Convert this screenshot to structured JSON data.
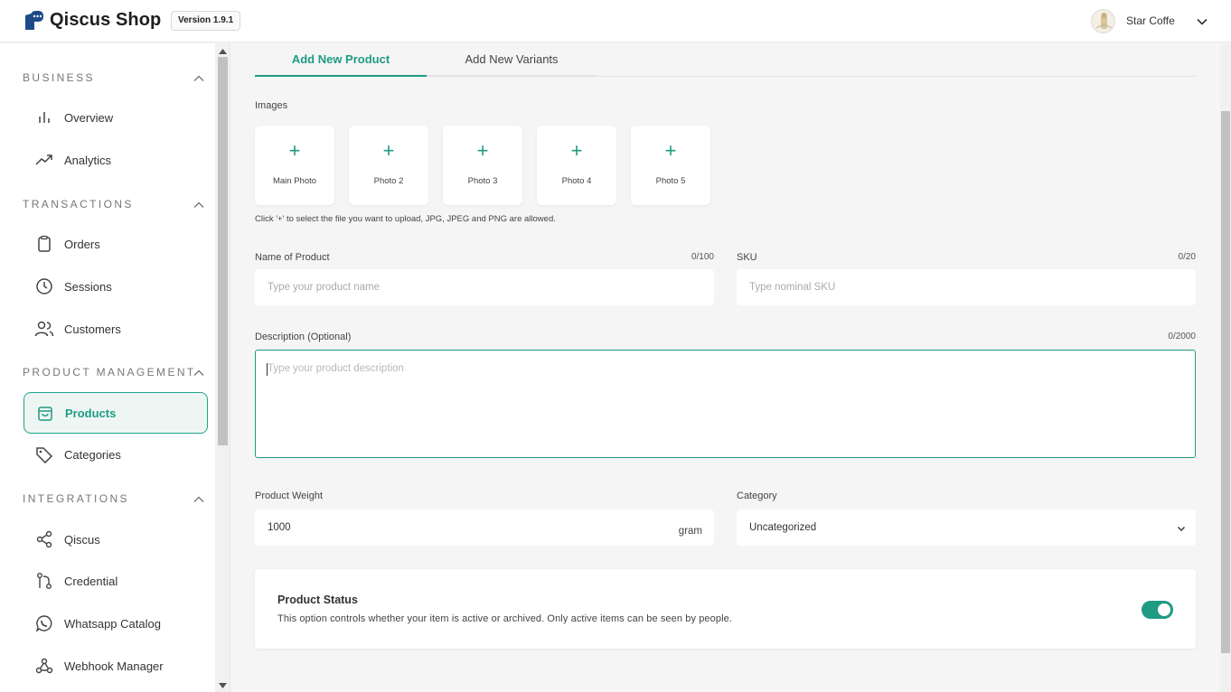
{
  "header": {
    "brand": "Qiscus Shop",
    "version": "Version 1.9.1",
    "store_name": "Star Coffe"
  },
  "sidebar": {
    "sections": [
      {
        "title": "BUSINESS"
      },
      {
        "title": "TRANSACTIONS"
      },
      {
        "title": "PRODUCT MANAGEMENT"
      },
      {
        "title": "INTEGRATIONS"
      }
    ],
    "items": [
      {
        "label": "Overview",
        "icon": "bar-chart-icon"
      },
      {
        "label": "Analytics",
        "icon": "trend-up-icon"
      },
      {
        "label": "Orders",
        "icon": "clipboard-icon"
      },
      {
        "label": "Sessions",
        "icon": "clock-icon"
      },
      {
        "label": "Customers",
        "icon": "users-icon"
      },
      {
        "label": "Products",
        "icon": "shopping-bag-icon",
        "active": true
      },
      {
        "label": "Categories",
        "icon": "tag-icon"
      },
      {
        "label": "Qiscus",
        "icon": "share-icon"
      },
      {
        "label": "Credential",
        "icon": "git-compare-icon"
      },
      {
        "label": "Whatsapp Catalog",
        "icon": "whatsapp-icon"
      },
      {
        "label": "Webhook Manager",
        "icon": "webhook-icon"
      }
    ]
  },
  "tabs": [
    {
      "label": "Add New Product",
      "active": true
    },
    {
      "label": "Add New Variants",
      "active": false
    }
  ],
  "images": {
    "label": "Images",
    "photos": [
      "Main Photo",
      "Photo 2",
      "Photo 3",
      "Photo 4",
      "Photo 5"
    ],
    "hint": "Click '+' to select the file you want to upload, JPG, JPEG and PNG are allowed."
  },
  "form": {
    "name": {
      "label": "Name of Product",
      "counter": "0/100",
      "placeholder": "Type your product name"
    },
    "sku": {
      "label": "SKU",
      "counter": "0/20",
      "placeholder": "Type nominal SKU"
    },
    "description": {
      "label": "Description (Optional)",
      "counter": "0/2000",
      "placeholder": "Type your product description"
    },
    "weight": {
      "label": "Product Weight",
      "value": "1000",
      "unit": "gram"
    },
    "category": {
      "label": "Category",
      "value": "Uncategorized"
    }
  },
  "status": {
    "title": "Product Status",
    "description": "This option controls whether your item is active or archived. Only active items can be seen by people.",
    "enabled": true
  },
  "colors": {
    "accent": "#1f9b82",
    "background": "#f5f5f5"
  }
}
